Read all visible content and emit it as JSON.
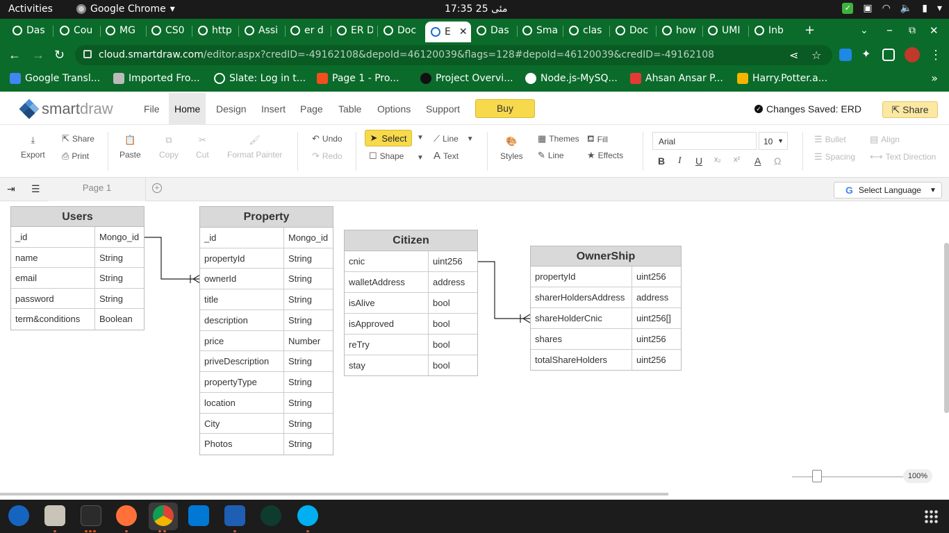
{
  "topbar": {
    "activities": "Activities",
    "app_name": "Google Chrome",
    "clock": "17:35  25 مئی"
  },
  "tabs": [
    {
      "label": "Das"
    },
    {
      "label": "Cou"
    },
    {
      "label": "MG"
    },
    {
      "label": "CS0"
    },
    {
      "label": "http"
    },
    {
      "label": "Assi"
    },
    {
      "label": "er d"
    },
    {
      "label": "ER D"
    },
    {
      "label": "Doc"
    },
    {
      "label": "E",
      "active": true
    },
    {
      "label": "Das"
    },
    {
      "label": "Sma"
    },
    {
      "label": "clas"
    },
    {
      "label": "Doc"
    },
    {
      "label": "how"
    },
    {
      "label": "UMI"
    },
    {
      "label": "Inb"
    }
  ],
  "address": {
    "domain": "cloud.smartdraw.com",
    "path": "/editor.aspx?credID=-49162108&depoId=46120039&flags=128#depoId=46120039&credID=-49162108"
  },
  "bookmarks": [
    {
      "label": "Google Transl..."
    },
    {
      "label": "Imported Fro..."
    },
    {
      "label": "Slate: Log in t..."
    },
    {
      "label": "Page 1 - Pro..."
    },
    {
      "label": "Project Overvi..."
    },
    {
      "label": "Node.js-MySQ..."
    },
    {
      "label": "Ahsan Ansar P..."
    },
    {
      "label": "Harry.Potter.a..."
    }
  ],
  "app": {
    "logo_a": "smart",
    "logo_b": "draw",
    "menu": [
      "File",
      "Home",
      "Design",
      "Insert",
      "Page",
      "Table",
      "Options",
      "Support"
    ],
    "buy_label": "Buy",
    "saved_status": "Changes Saved: ERD",
    "share_label": "Share"
  },
  "ribbon": {
    "export": "Export",
    "share": "Share",
    "print": "Print",
    "paste": "Paste",
    "copy": "Copy",
    "cut": "Cut",
    "format_painter": "Format Painter",
    "undo": "Undo",
    "redo": "Redo",
    "select": "Select",
    "shape": "Shape",
    "line": "Line",
    "text": "Text",
    "styles": "Styles",
    "themes": "Themes",
    "line2": "Line",
    "fill": "Fill",
    "effects": "Effects",
    "font": "Arial",
    "size": "10",
    "bullet": "Bullet",
    "align": "Align",
    "spacing": "Spacing",
    "text_direction": "Text Direction"
  },
  "pagebar": {
    "page_tab": "Page 1",
    "language": "Select Language"
  },
  "diagram": {
    "users": {
      "title": "Users",
      "rows": [
        [
          "_id",
          "Mongo_id"
        ],
        [
          "name",
          "String"
        ],
        [
          "email",
          "String"
        ],
        [
          "password",
          "String"
        ],
        [
          "term&conditions",
          "Boolean"
        ]
      ]
    },
    "property": {
      "title": "Property",
      "rows": [
        [
          "_id",
          "Mongo_id"
        ],
        [
          "propertyId",
          "String"
        ],
        [
          "ownerId",
          "String"
        ],
        [
          "title",
          "String"
        ],
        [
          "description",
          "String"
        ],
        [
          "price",
          "Number"
        ],
        [
          "priveDescription",
          "String"
        ],
        [
          "propertyType",
          "String"
        ],
        [
          "location",
          "String"
        ],
        [
          "City",
          "String"
        ],
        [
          "Photos",
          "String"
        ]
      ]
    },
    "citizen": {
      "title": "Citizen",
      "rows": [
        [
          "cnic",
          "uint256"
        ],
        [
          "walletAddress",
          "address"
        ],
        [
          "isAlive",
          "bool"
        ],
        [
          "isApproved",
          "bool"
        ],
        [
          "reTry",
          "bool"
        ],
        [
          "stay",
          "bool"
        ]
      ]
    },
    "ownership": {
      "title": "OwnerShip",
      "rows": [
        [
          "propertyId",
          "uint256"
        ],
        [
          "sharerHoldersAddress",
          "address"
        ],
        [
          "shareHolderCnic",
          "uint256[]"
        ],
        [
          "shares",
          "uint256"
        ],
        [
          "totalShareHolders",
          "uint256"
        ]
      ]
    }
  },
  "zoom": "100%"
}
